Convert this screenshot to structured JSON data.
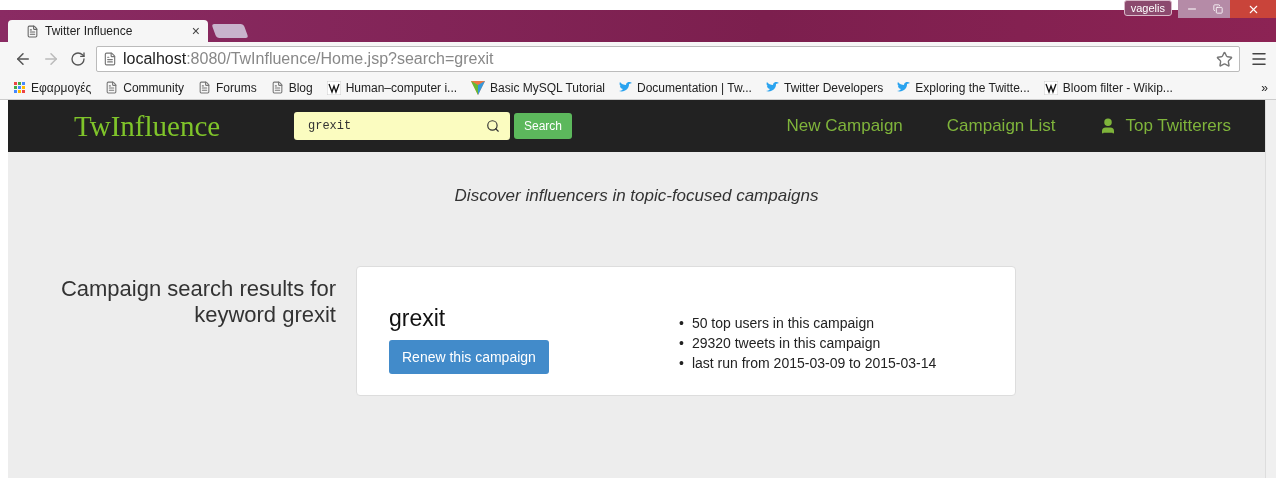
{
  "browser": {
    "tab": {
      "title": "Twitter Influence",
      "close": "×",
      "selected": true
    },
    "url": {
      "host": "localhost",
      "path": ":8080/TwInfluence/Home.jsp?search=grexit"
    },
    "profile": "vagelis",
    "bookmarks": [
      {
        "label": "Εφαρμογές",
        "kind": "apps"
      },
      {
        "label": "Community",
        "kind": "page"
      },
      {
        "label": "Forums",
        "kind": "page"
      },
      {
        "label": "Blog",
        "kind": "page"
      },
      {
        "label": "Human–computer i...",
        "kind": "wiki"
      },
      {
        "label": "Basic MySQL Tutorial",
        "kind": "mysql"
      },
      {
        "label": "Documentation | Tw...",
        "kind": "bird"
      },
      {
        "label": "Twitter Developers",
        "kind": "bird"
      },
      {
        "label": "Exploring the Twitte...",
        "kind": "bird"
      },
      {
        "label": "Bloom filter - Wikip...",
        "kind": "wiki"
      }
    ],
    "more": "»"
  },
  "navbar": {
    "brand": "TwInfluence",
    "search": {
      "value": "grexit"
    },
    "search_button": "Search",
    "links": [
      {
        "label": "New Campaign",
        "kind": "text"
      },
      {
        "label": "Campaign List",
        "kind": "text"
      },
      {
        "label": "Top Twitterers",
        "kind": "user"
      }
    ]
  },
  "tagline": "Discover influencers in topic-focused campaigns",
  "results": {
    "heading": "Campaign search results for keyword grexit",
    "campaigns": [
      {
        "name": "grexit",
        "bullet": "•",
        "button": "Renew this campaign",
        "facts": [
          "50 top users in this campaign",
          "29320 tweets in this campaign",
          "last run from 2015-03-09 to 2015-03-14"
        ]
      }
    ]
  }
}
